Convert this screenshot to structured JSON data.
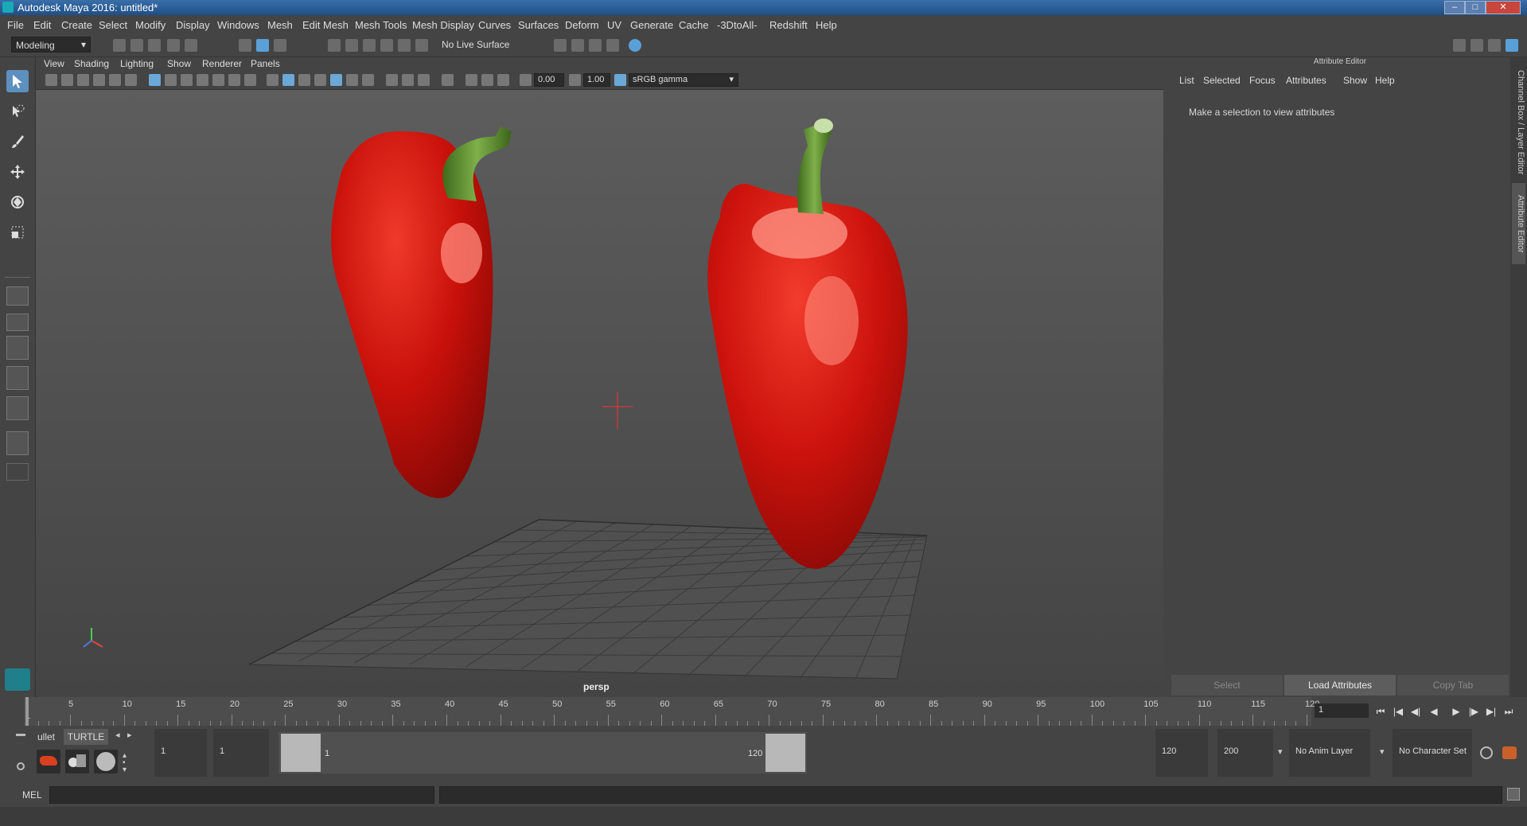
{
  "window": {
    "title": "Autodesk Maya 2016: untitled*",
    "controls": {
      "minimize": "–",
      "maximize": "□",
      "close": "✕"
    }
  },
  "menus": [
    "File",
    "Edit",
    "Create",
    "Select",
    "Modify",
    "Display",
    "Windows",
    "Mesh",
    "Edit Mesh",
    "Mesh Tools",
    "Mesh Display",
    "Curves",
    "Surfaces",
    "Deform",
    "UV",
    "Generate",
    "Cache",
    "-3DtoAll-",
    "Redshift",
    "Help"
  ],
  "status_line": {
    "mode": "Modeling",
    "live_surface": "No Live Surface"
  },
  "viewport": {
    "menus": [
      "View",
      "Shading",
      "Lighting",
      "Show",
      "Renderer",
      "Panels"
    ],
    "exposure": "0.00",
    "gamma": "1.00",
    "color_space": "sRGB gamma",
    "camera": "persp"
  },
  "attribute_editor": {
    "title": "Attribute Editor",
    "menus": [
      "List",
      "Selected",
      "Focus",
      "Attributes",
      "Show",
      "Help"
    ],
    "message": "Make a selection to view attributes",
    "buttons": {
      "select": "Select",
      "load": "Load Attributes",
      "copy": "Copy Tab"
    },
    "side_tabs": [
      "Channel Box / Layer Editor",
      "Attribute Editor"
    ]
  },
  "time_slider": {
    "labels": [
      "1",
      "5",
      "10",
      "15",
      "20",
      "25",
      "30",
      "35",
      "40",
      "45",
      "50",
      "55",
      "60",
      "65",
      "70",
      "75",
      "80",
      "85",
      "90",
      "95",
      "100",
      "105",
      "110",
      "115",
      "120"
    ],
    "current_frame": "1",
    "playback": [
      "⏮",
      "|◀",
      "◀|",
      "◀",
      "▶",
      "|▶",
      "▶|",
      "⏭"
    ]
  },
  "range_slider": {
    "shelf_tabs": [
      "ullet",
      "TURTLE"
    ],
    "start": "1",
    "anim_start": "1",
    "range_start": "1",
    "range_end": "120",
    "anim_end": "120",
    "end": "200",
    "anim_layer": "No Anim Layer",
    "character_set": "No Character Set"
  },
  "command_line": {
    "label": "MEL"
  },
  "colors": {
    "accent": "#5d8fbf",
    "pepper": "#c8100a",
    "stem": "#5f8f2e",
    "bg": "#444444"
  }
}
